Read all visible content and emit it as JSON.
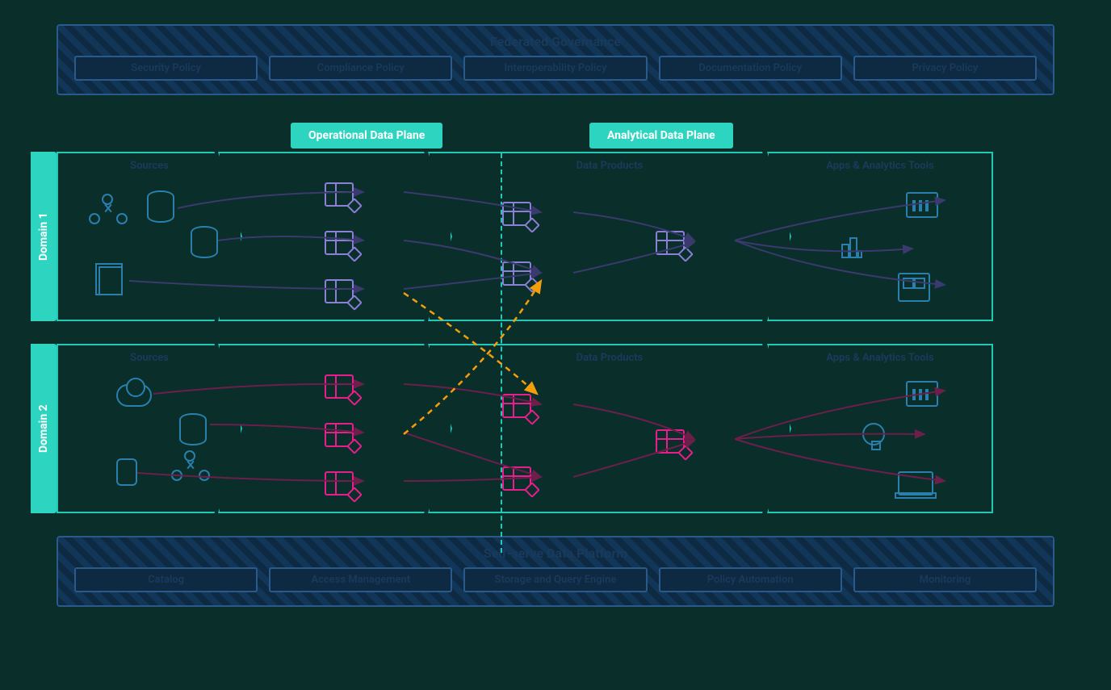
{
  "governance": {
    "title": "Federated Governance",
    "policies": [
      "Security Policy",
      "Compliance Policy",
      "Interoperability Policy",
      "Documentation Policy",
      "Privacy Policy"
    ]
  },
  "planes": {
    "operational": "Operational Data Plane",
    "analytical": "Analytical Data Plane"
  },
  "stages": {
    "sources": "Sources",
    "products": "Data Products",
    "apps": "Apps & Analytics Tools"
  },
  "domains": {
    "d1": "Domain 1",
    "d2": "Domain 2"
  },
  "platform": {
    "title": "Self-serve Data Platform",
    "capabilities": [
      "Catalog",
      "Access Management",
      "Storage and Query Engine",
      "Policy Automation",
      "Monitoring"
    ]
  },
  "colors": {
    "domain1_flow": "#3a3a6e",
    "domain2_flow": "#6b1f4a",
    "cross_domain": "#f59e0b",
    "teal": "#1ec9b7",
    "purple": "#8b7fd6",
    "magenta": "#e91e8c"
  }
}
